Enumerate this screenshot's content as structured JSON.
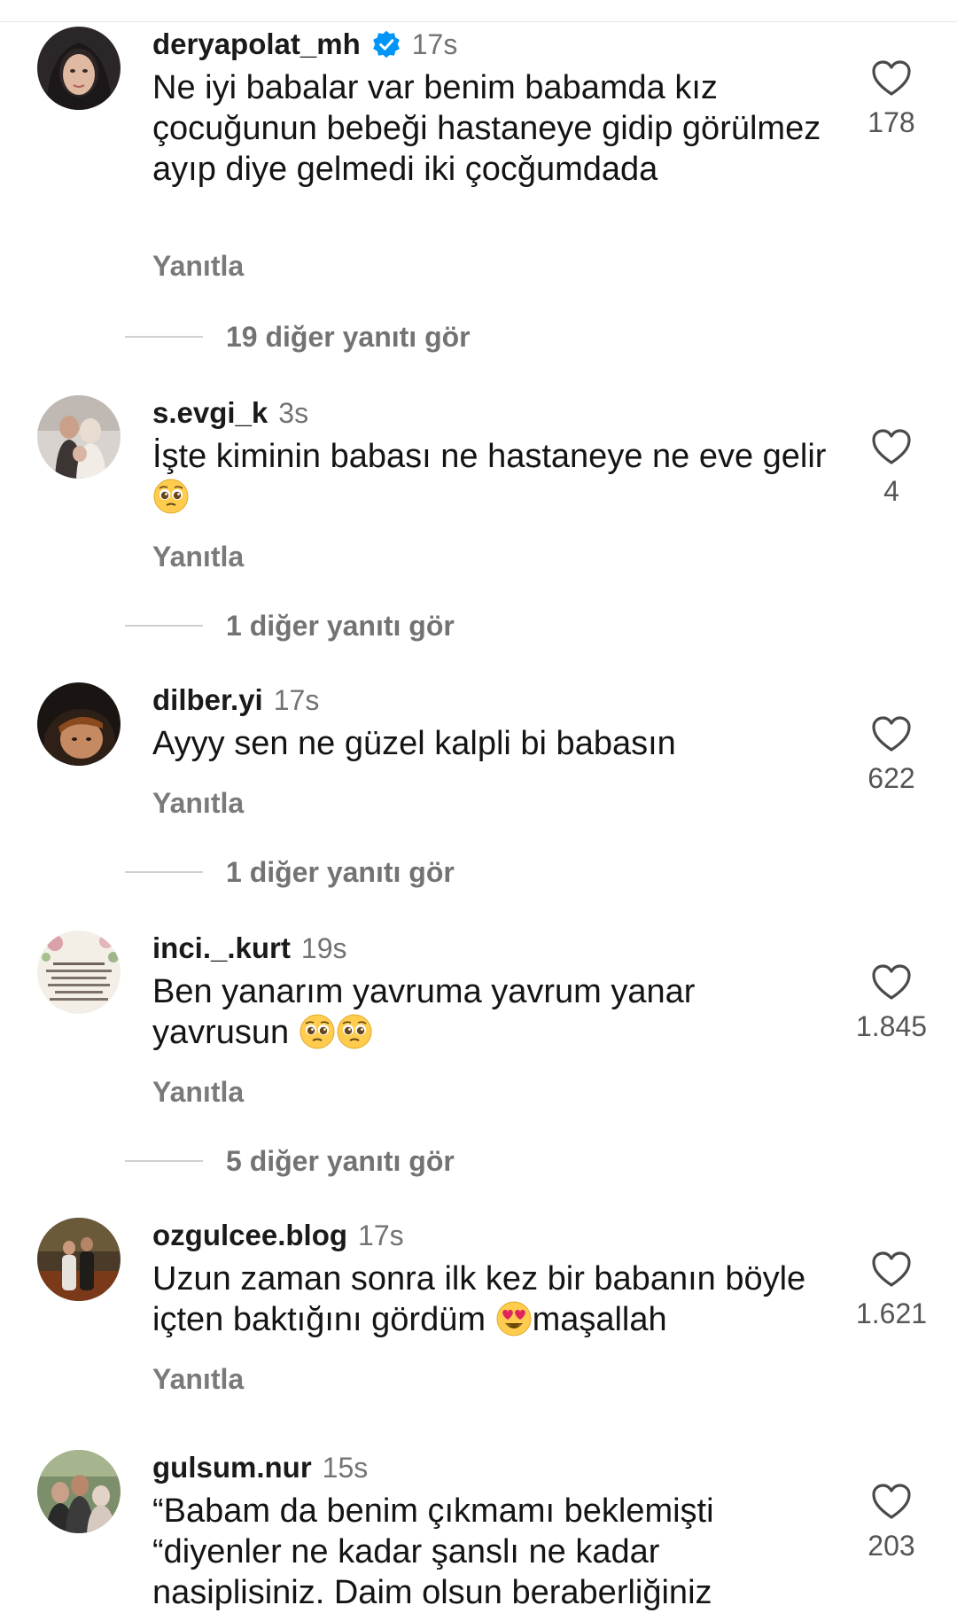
{
  "comments": [
    {
      "username": "deryapolat_mh",
      "verified": true,
      "time": "17s",
      "text": "Ne iyi babalar var benim babamda kız çocuğunun bebeği hastaneye gidip görülmez ayıp diye gelmedi iki çocğumdada",
      "reply_label": "Yanıtla",
      "likes": "178",
      "view_replies": "19 diğer yanıtı gör"
    },
    {
      "username": "s.evgi_k",
      "time": "3s",
      "text_before_emoji": "İşte kiminin babası ne hastaneye ne eve gelir ",
      "emoji": "pleading-face",
      "reply_label": "Yanıtla",
      "likes": "4",
      "view_replies": "1 diğer yanıtı gör"
    },
    {
      "username": "dilber.yi",
      "time": "17s",
      "text": "Ayyy sen ne güzel kalpli bi babasın",
      "reply_label": "Yanıtla",
      "likes": "622",
      "view_replies": "1 diğer yanıtı gör"
    },
    {
      "username": "inci._.kurt",
      "time": "19s",
      "text_before_emoji": "Ben yanarım yavruma yavrum yanar yavrusun ",
      "emoji": "pleading-face-x2",
      "reply_label": "Yanıtla",
      "likes": "1.845",
      "view_replies": "5 diğer yanıtı gör"
    },
    {
      "username": "ozgulcee.blog",
      "time": "17s",
      "text_before_emoji": "Uzun zaman sonra ilk kez bir babanın böyle içten baktığını gördüm ",
      "emoji": "heart-eyes",
      "text_after_emoji": "maşallah",
      "reply_label": "Yanıtla",
      "likes": "1.621"
    },
    {
      "username": "gulsum.nur",
      "time": "15s",
      "text": "“Babam da benim çıkmamı beklemişti “diyenler ne kadar şanslı ne kadar nasiplisiniz. Daim olsun beraberliğiniz",
      "likes": "203"
    }
  ],
  "colors": {
    "verified_blue": "#0095f6",
    "secondary_text": "#737373"
  },
  "icons": {
    "like": "heart-outline-icon",
    "verified": "verified-badge-icon"
  }
}
